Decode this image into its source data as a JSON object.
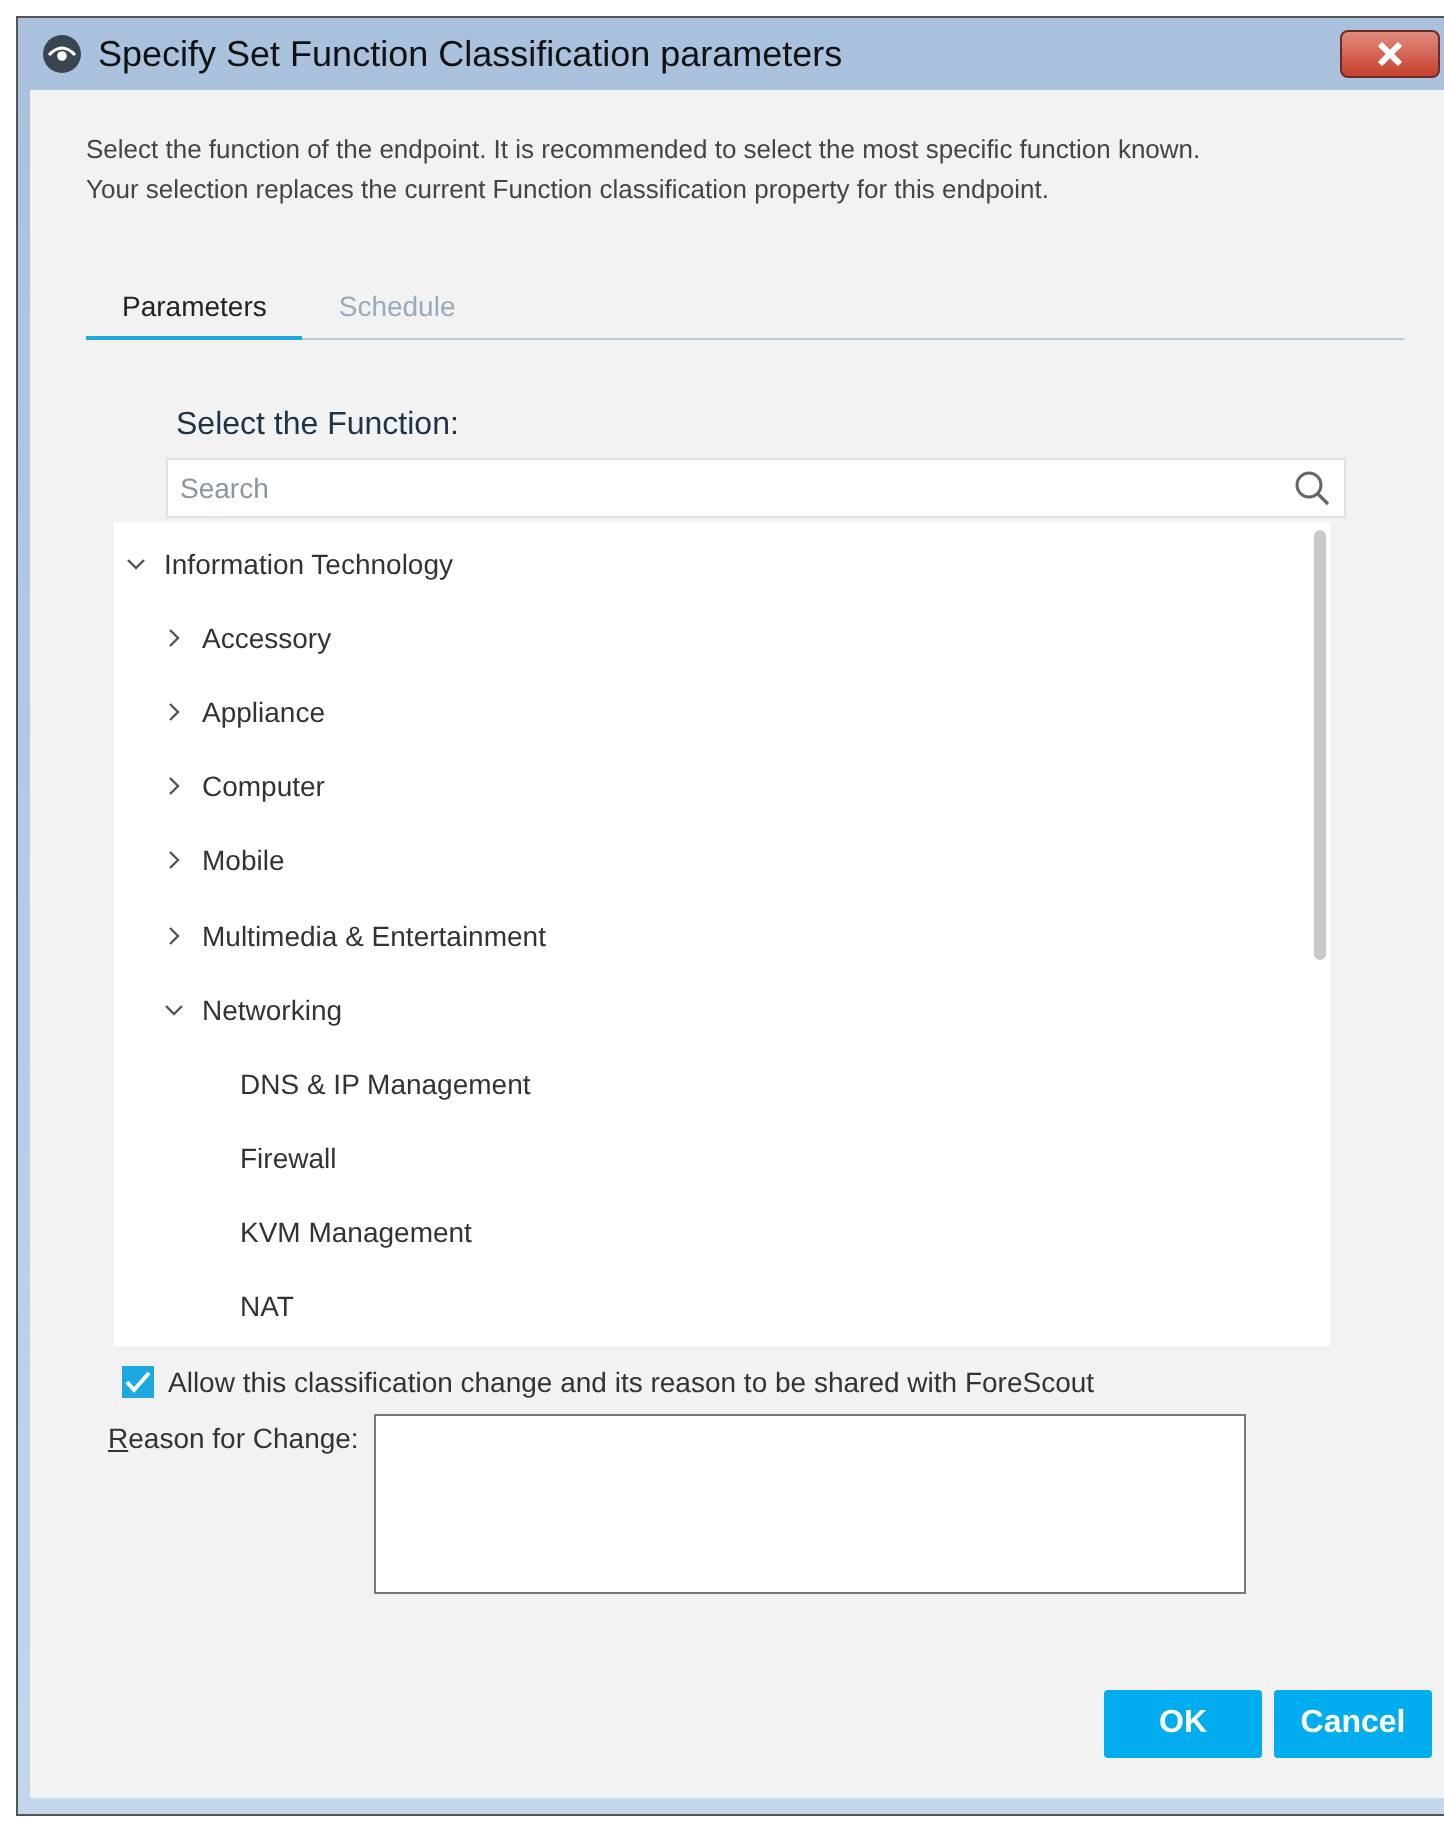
{
  "window": {
    "title": "Specify Set Function Classification parameters"
  },
  "description": "Select the function of the endpoint. It is recommended to select the most specific function known. Your selection replaces the current Function classification property for this endpoint.",
  "tabs": [
    {
      "label": "Parameters",
      "selected": true
    },
    {
      "label": "Schedule",
      "selected": false
    }
  ],
  "function_label": "Select the Function:",
  "search": {
    "placeholder": "Search"
  },
  "tree": [
    {
      "kind": "group",
      "label": "Information Technology",
      "expanded": true,
      "children": [
        {
          "kind": "group",
          "label": "Accessory",
          "expanded": false
        },
        {
          "kind": "group",
          "label": "Appliance",
          "expanded": false
        },
        {
          "kind": "group",
          "label": "Computer",
          "expanded": false
        },
        {
          "kind": "group",
          "label": "Mobile",
          "expanded": false
        },
        {
          "kind": "group",
          "label": "Multimedia & Entertainment",
          "expanded": false
        },
        {
          "kind": "group",
          "label": "Networking",
          "expanded": true,
          "children": [
            {
              "kind": "leaf",
              "label": "DNS & IP Management"
            },
            {
              "kind": "leaf",
              "label": "Firewall"
            },
            {
              "kind": "leaf",
              "label": "KVM Management"
            },
            {
              "kind": "leaf",
              "label": "NAT"
            }
          ]
        }
      ]
    }
  ],
  "share": {
    "label": "Allow this classification change and its reason to be shared with ForeScout",
    "checked": true
  },
  "reason": {
    "label": "Reason for Change:"
  },
  "buttons": [
    "OK",
    "Cancel"
  ]
}
